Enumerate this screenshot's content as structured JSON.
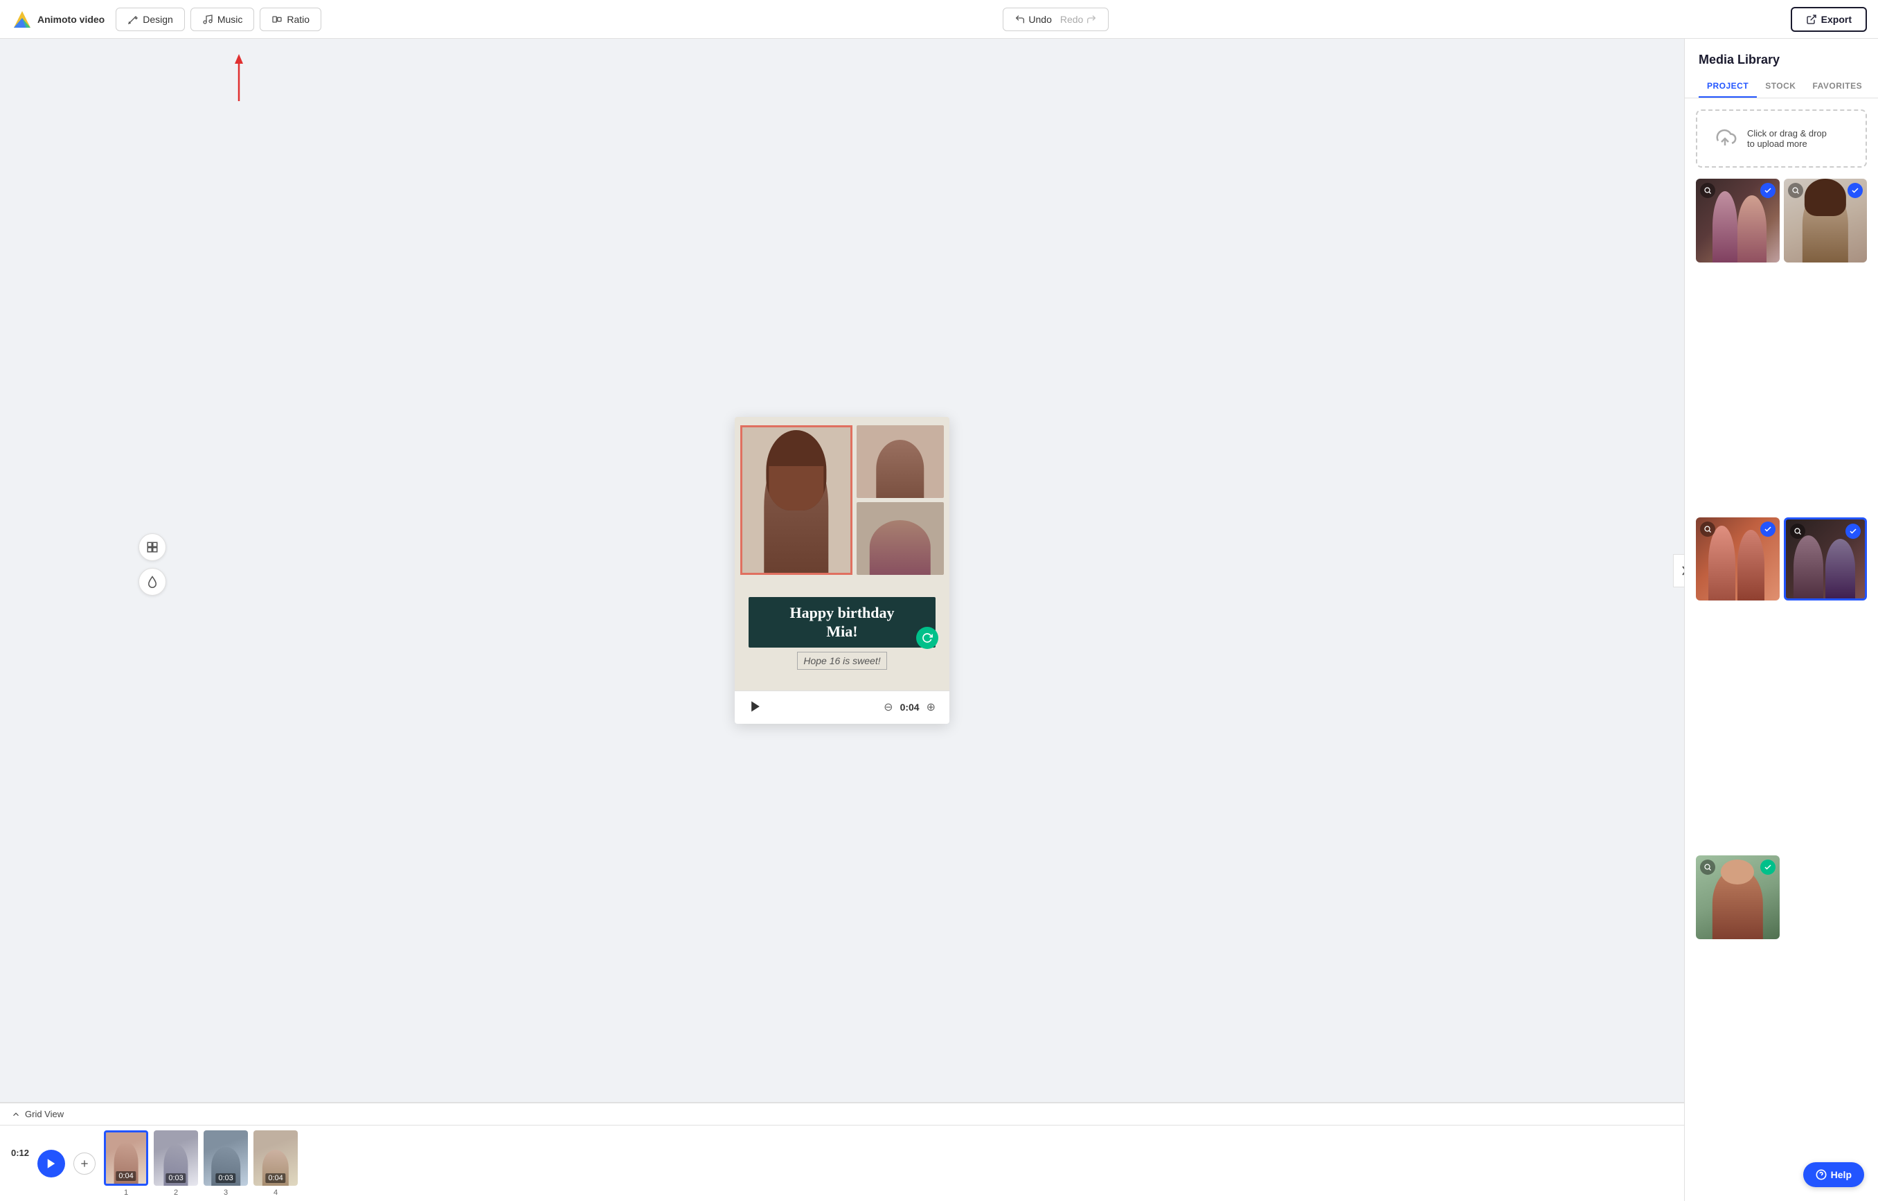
{
  "nav": {
    "logo_text": "Animoto video",
    "design_label": "Design",
    "music_label": "Music",
    "ratio_label": "Ratio",
    "undo_label": "Undo",
    "redo_label": "Redo",
    "export_label": "Export"
  },
  "preview": {
    "birthday_line1": "Happy birthday",
    "birthday_line2": "Mia!",
    "subtitle": "Hope 16 is sweet!",
    "time": "0:04"
  },
  "timeline": {
    "total_time": "0:12",
    "clips": [
      {
        "id": 1,
        "time": "0:04",
        "num": "1",
        "color": "clip-c1",
        "selected": true
      },
      {
        "id": 2,
        "time": "0:03",
        "num": "2",
        "color": "clip-c2",
        "selected": false
      },
      {
        "id": 3,
        "time": "0:03",
        "num": "3",
        "color": "clip-c3",
        "selected": false
      },
      {
        "id": 4,
        "time": "0:04",
        "num": "4",
        "color": "clip-c4",
        "selected": false
      }
    ]
  },
  "right_panel": {
    "title": "Media Library",
    "tabs": [
      {
        "id": "project",
        "label": "PROJECT",
        "active": true
      },
      {
        "id": "stock",
        "label": "STOCK",
        "active": false
      },
      {
        "id": "favorites",
        "label": "FAVORITES",
        "active": false
      }
    ],
    "upload": {
      "line1": "Click or drag & drop",
      "line2": "to upload more"
    },
    "media_items": [
      {
        "id": 1,
        "bg": "photo-bg-1",
        "checked": true,
        "check_style": "checked"
      },
      {
        "id": 2,
        "bg": "photo-bg-2",
        "checked": true,
        "check_style": "checked"
      },
      {
        "id": 3,
        "bg": "photo-bg-3",
        "checked": true,
        "check_style": "checked"
      },
      {
        "id": 4,
        "bg": "photo-bg-4",
        "checked": true,
        "check_style": "checked-selected",
        "selected": true
      },
      {
        "id": 5,
        "bg": "photo-bg-5",
        "checked": true,
        "check_style": "checked-green"
      }
    ]
  },
  "grid_view_label": "Grid View",
  "help_label": "Help"
}
